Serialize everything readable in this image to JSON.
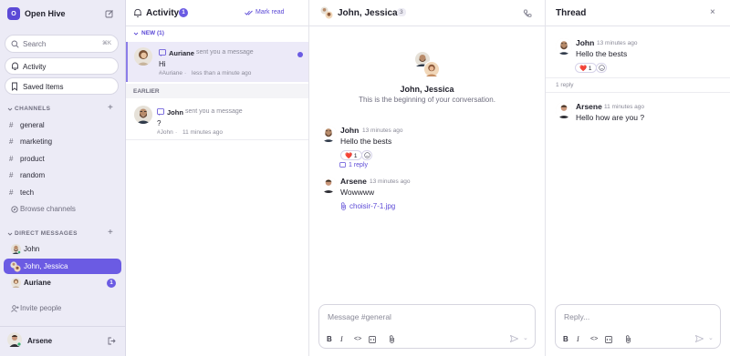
{
  "sidebar": {
    "workspace_initial": "O",
    "workspace_name": "Open Hive",
    "search_placeholder": "Search",
    "search_shortcut": "⌘K",
    "activity_label": "Activity",
    "saved_label": "Saved Items",
    "channels_heading": "CHANNELS",
    "channels": [
      "general",
      "marketing",
      "product",
      "random",
      "tech"
    ],
    "browse_channels": "Browse channels",
    "dm_heading": "DIRECT MESSAGES",
    "dms": [
      {
        "name": "John",
        "badge": ""
      },
      {
        "name": "John, Jessica",
        "badge": ""
      },
      {
        "name": "Auriane",
        "badge": "1"
      }
    ],
    "invite_label": "Invite people",
    "current_user": "Arsene"
  },
  "activity": {
    "title": "Activity",
    "count": "1",
    "mark_read": "Mark read",
    "new_heading": "NEW (1)",
    "earlier_heading": "EARLIER",
    "new_items": [
      {
        "name": "Auriane",
        "action": "sent you a message",
        "text": "Hi",
        "channel": "#Auriane",
        "time": "less than a minute ago"
      }
    ],
    "earlier_items": [
      {
        "name": "John",
        "action": "sent you a message",
        "text": "?",
        "channel": "#John",
        "time": "11 minutes ago"
      }
    ]
  },
  "chat": {
    "title": "John, Jessica",
    "member_count": "3",
    "intro_name": "John, Jessica",
    "intro_text": "This is the beginning of your conversation.",
    "messages": [
      {
        "author": "John",
        "time": "13 minutes ago",
        "text": "Hello the bests",
        "reaction": "❤️ 1",
        "replies": "1 reply"
      },
      {
        "author": "Arsene",
        "time": "13 minutes ago",
        "text": "Wowwww",
        "attachment": "choisir-7-1.jpg"
      }
    ],
    "composer_placeholder": "Message #general"
  },
  "thread": {
    "title": "Thread",
    "parent": {
      "author": "John",
      "time": "13 minutes ago",
      "text": "Hello the bests",
      "reaction": "❤️ 1"
    },
    "reply_count": "1 reply",
    "replies": [
      {
        "author": "Arsene",
        "time": "11 minutes ago",
        "text": "Hello how are you ?"
      }
    ],
    "composer_placeholder": "Reply..."
  },
  "colors": {
    "accent": "#6b5be3",
    "sidebar_bg": "#ecebf6",
    "selected_bg": "#eceaf8",
    "link": "#5b49d6"
  }
}
